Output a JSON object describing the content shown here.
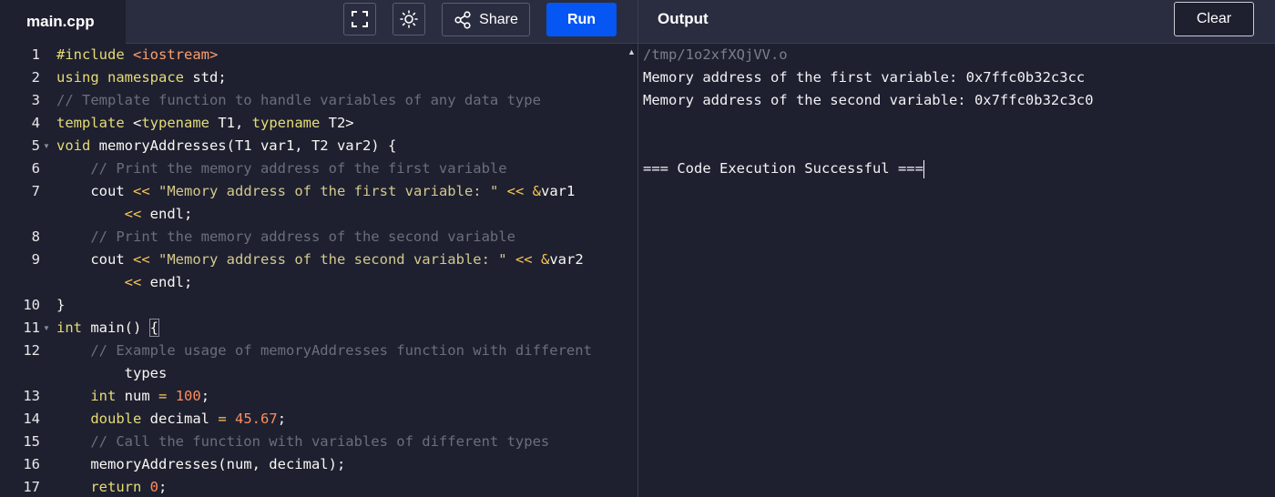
{
  "editor": {
    "file_tab": "main.cpp",
    "run_label": "Run",
    "share_label": "Share",
    "icons": [
      "fullscreen-icon",
      "theme-sun-icon",
      "share-icon"
    ],
    "line_numbers": [
      "1",
      "2",
      "3",
      "4",
      "5",
      "6",
      "7",
      "",
      "8",
      "9",
      "",
      "10",
      "11",
      "12",
      "",
      "13",
      "14",
      "15",
      "16",
      "17"
    ],
    "code_lines": [
      "#include <iostream>",
      "using namespace std;",
      "// Template function to handle variables of any data type",
      "template <typename T1, typename T2>",
      "void memoryAddresses(T1 var1, T2 var2) {",
      "    // Print the memory address of the first variable",
      "    cout << \"Memory address of the first variable: \" << &var1",
      "        << endl;",
      "    // Print the memory address of the second variable",
      "    cout << \"Memory address of the second variable: \" << &var2",
      "        << endl;",
      "}",
      "int main() {",
      "    // Example usage of memoryAddresses function with different",
      "        types",
      "    int num = 100;",
      "    double decimal = 45.67;",
      "    // Call the function with variables of different types",
      "    memoryAddresses(num, decimal);",
      "    return 0;"
    ]
  },
  "output": {
    "title": "Output",
    "clear_label": "Clear",
    "path": "/tmp/1o2xfXQjVV.o",
    "lines": [
      "Memory address of the first variable: 0x7ffc0b32c3cc",
      "Memory address of the second variable: 0x7ffc0b32c3c0",
      "",
      "",
      "=== Code Execution Successful ==="
    ]
  },
  "colors": {
    "run_button": "#0556f3",
    "background": "#1e2030",
    "topbar": "#2a2d3f"
  }
}
